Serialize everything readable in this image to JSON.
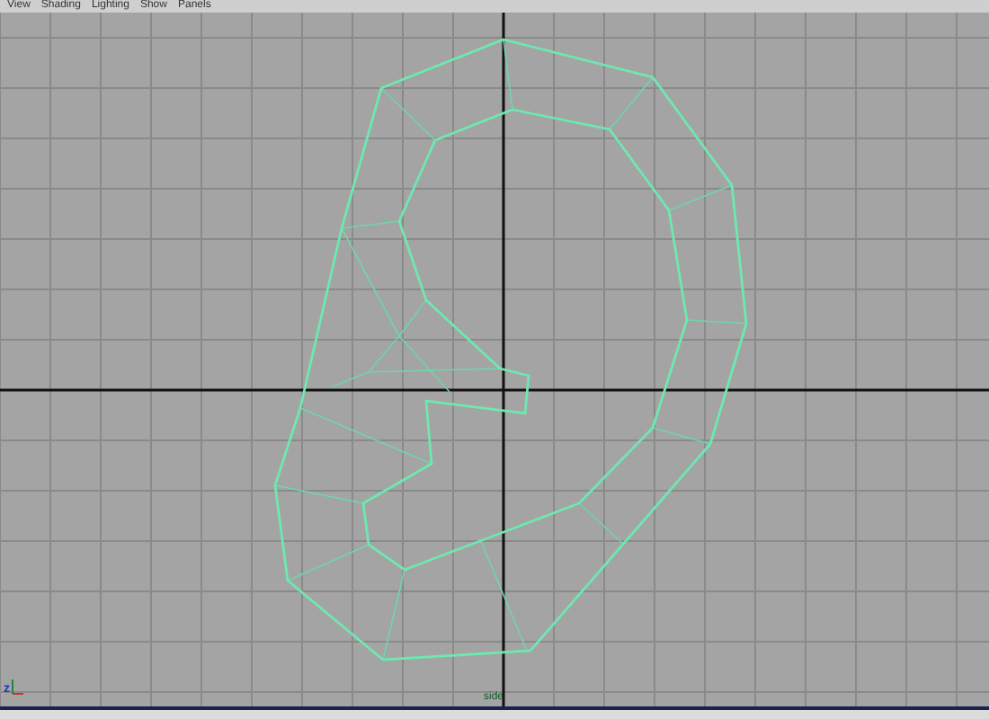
{
  "menu_bar": {
    "items": [
      "View",
      "Shading",
      "Lighting",
      "Show",
      "Panels"
    ]
  },
  "viewport": {
    "camera_label": "side",
    "axis_indicator_label": "z"
  }
}
